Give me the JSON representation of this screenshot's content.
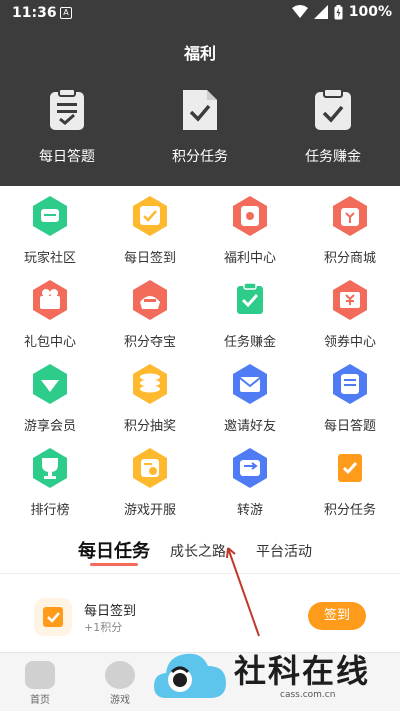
{
  "status_bar": {
    "time": "11:36",
    "notification_glyph": "A",
    "battery_text": "100%"
  },
  "header": {
    "title": "福利",
    "features": [
      {
        "label": "每日答题",
        "icon": "clipboard-list-icon"
      },
      {
        "label": "积分任务",
        "icon": "document-check-icon"
      },
      {
        "label": "任务赚金",
        "icon": "clipboard-check-icon"
      }
    ]
  },
  "grid": [
    {
      "label": "玩家社区",
      "icon": "chat-icon",
      "color": "#2ecc8a"
    },
    {
      "label": "每日签到",
      "icon": "calendar-icon",
      "color": "#ffb92e"
    },
    {
      "label": "福利中心",
      "icon": "gift-envelope-icon",
      "color": "#f26b5b"
    },
    {
      "label": "积分商城",
      "icon": "shop-bag-icon",
      "color": "#f26b5b"
    },
    {
      "label": "礼包中心",
      "icon": "gift-box-icon",
      "color": "#f26b5b"
    },
    {
      "label": "积分夺宝",
      "icon": "treasure-icon",
      "color": "#f26b5b"
    },
    {
      "label": "任务赚金",
      "icon": "task-check-icon",
      "color": "#2ecc8a"
    },
    {
      "label": "领券中心",
      "icon": "coupon-icon",
      "color": "#f26b5b"
    },
    {
      "label": "游享会员",
      "icon": "vip-diamond-icon",
      "color": "#2ecc8a"
    },
    {
      "label": "积分抽奖",
      "icon": "coin-stack-icon",
      "color": "#ffb92e"
    },
    {
      "label": "邀请好友",
      "icon": "invite-mail-icon",
      "color": "#4f7cf5"
    },
    {
      "label": "每日答题",
      "icon": "quiz-icon",
      "color": "#4f7cf5"
    },
    {
      "label": "排行榜",
      "icon": "trophy-icon",
      "color": "#2ecc8a"
    },
    {
      "label": "游戏开服",
      "icon": "server-clock-icon",
      "color": "#ffb92e"
    },
    {
      "label": "转游",
      "icon": "transfer-icon",
      "color": "#4f7cf5"
    },
    {
      "label": "积分任务",
      "icon": "points-task-icon",
      "color": "#ff9b1a"
    }
  ],
  "tabs": [
    {
      "label": "每日任务",
      "active": true
    },
    {
      "label": "成长之路",
      "active": false
    },
    {
      "label": "平台活动",
      "active": false
    }
  ],
  "task": {
    "name": "每日签到",
    "points": "+1积分",
    "button": "签到"
  },
  "bottom_nav": [
    {
      "label": "首页",
      "icon": "gamepad-icon"
    },
    {
      "label": "游戏",
      "icon": "heart-icon"
    }
  ],
  "watermark": {
    "brand": "社科在线",
    "url": "cass.com.cn"
  },
  "colors": {
    "header_bg": "#3c3c3c",
    "accent": "#f26b5b",
    "button": "#ff9b1a"
  }
}
